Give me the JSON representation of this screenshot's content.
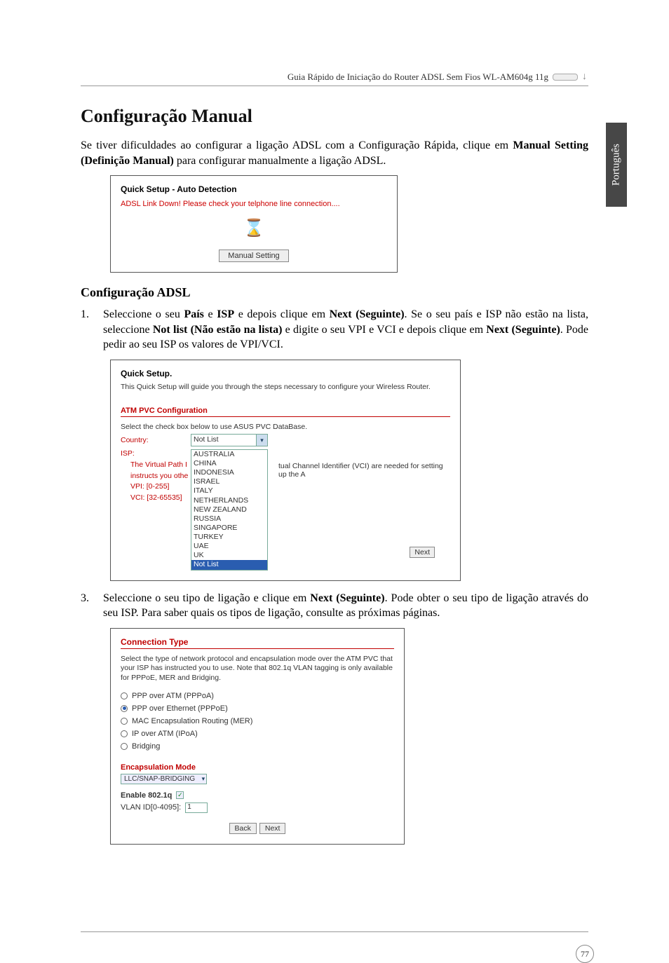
{
  "header": {
    "text": "Guia Rápido de Iniciação do Router ADSL Sem Fios WL-AM604g 11g"
  },
  "lang_tab": "Português",
  "title": "Configuração Manual",
  "intro_pre": "Se tiver dificuldades ao configurar a ligação ADSL com a Configuração Rápida, clique em ",
  "intro_bold": "Manual Setting (Definição Manual)",
  "intro_post": " para configurar manualmente a ligação ADSL.",
  "shot1": {
    "title": "Quick Setup - Auto Detection",
    "alert": "ADSL Link Down! Please check your telphone line connection....",
    "hourglass": "⌛",
    "button": "Manual Setting"
  },
  "sub_h": "Configuração ADSL",
  "step1": {
    "num": "1.",
    "p1": "Seleccione o seu ",
    "b1": "País",
    "p2": " e ",
    "b2": "ISP",
    "p3": " e depois clique em ",
    "b3": "Next (Seguinte)",
    "p4": ". Se o seu país e ISP não estão na lista, seleccione ",
    "b4": "Not list (Não estão na lista)",
    "p5": " e digite o seu VPI e VCI e depois clique em ",
    "b5": "Next (Seguinte)",
    "p6": ". Pode pedir ao seu ISP os valores de VPI/VCI."
  },
  "shot2": {
    "title": "Quick Setup.",
    "desc": "This Quick Setup will guide you through the steps necessary to configure your Wireless Router.",
    "section": "ATM PVC Configuration",
    "selline": "Select the check box below to use ASUS PVC DataBase.",
    "country_lbl": "Country:",
    "country_val": "Not List",
    "isp_lbl": "ISP:",
    "left_lines": [
      "The Virtual Path I",
      "instructs you othe",
      "VPI: [0-255]",
      "VCI: [32-65535]"
    ],
    "list": [
      "AUSTRALIA",
      "CHINA",
      "INDONESIA",
      "ISRAEL",
      "ITALY",
      "NETHERLANDS",
      "NEW ZEALAND",
      "RUSSIA",
      "SINGAPORE",
      "TURKEY",
      "UAE",
      "UK",
      "Not List"
    ],
    "selected": "Not List",
    "trail": "tual Channel Identifier (VCI) are needed for setting up the A",
    "next": "Next"
  },
  "step3": {
    "num": "3.",
    "p1": "Seleccione o seu tipo de ligação e clique em ",
    "b1": "Next (Seguinte)",
    "p2": ". Pode obter o seu tipo de ligação através do seu ISP. Para saber quais os tipos de ligação, consulte as próximas páginas."
  },
  "shot3": {
    "title": "Connection Type",
    "desc": "Select the type of network protocol and encapsulation mode over the ATM PVC that your ISP has instructed you to use. Note that 802.1q VLAN tagging is only available for PPPoE, MER and Bridging.",
    "radios": [
      {
        "label": "PPP over ATM (PPPoA)",
        "checked": false
      },
      {
        "label": "PPP over Ethernet (PPPoE)",
        "checked": true
      },
      {
        "label": "MAC Encapsulation Routing (MER)",
        "checked": false
      },
      {
        "label": "IP over ATM (IPoA)",
        "checked": false
      },
      {
        "label": "Bridging",
        "checked": false
      }
    ],
    "encap_h": "Encapsulation Mode",
    "encap_val": "LLC/SNAP-BRIDGING",
    "enable_lbl": "Enable 802.1q",
    "enable_chk": "✓",
    "vlan_lbl": "VLAN ID[0-4095]:",
    "vlan_val": "1",
    "back": "Back",
    "next": "Next"
  },
  "page_number": "77"
}
